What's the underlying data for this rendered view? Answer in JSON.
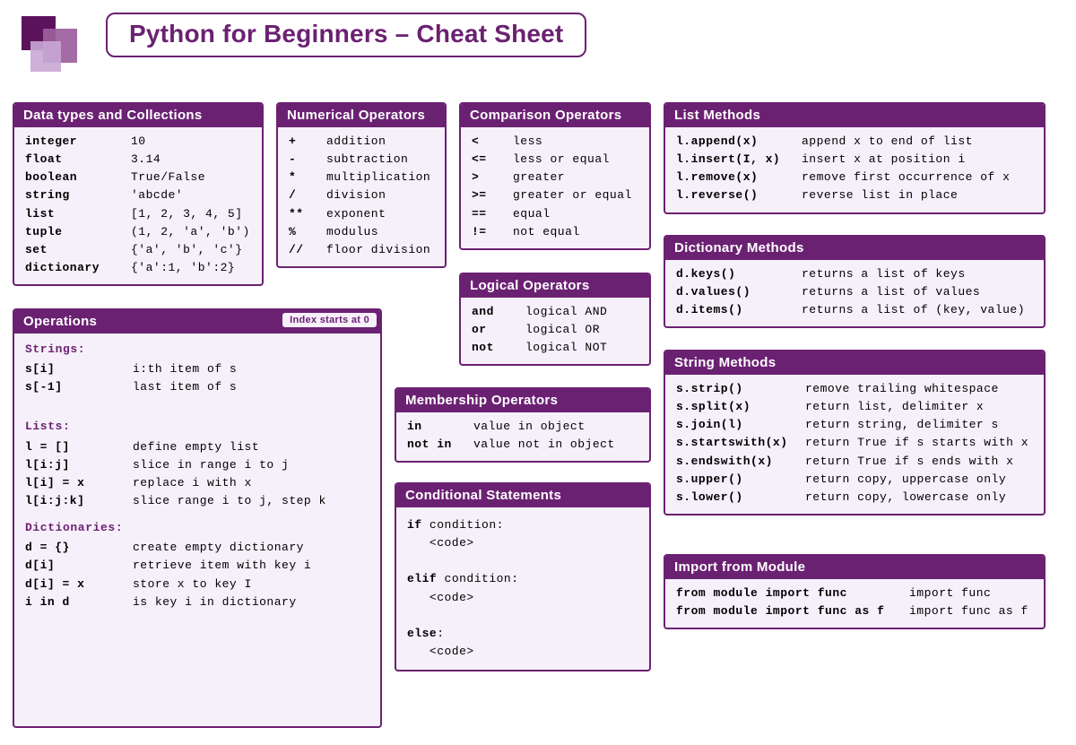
{
  "title": "Python for Beginners – Cheat Sheet",
  "cards": {
    "datatypes": {
      "header": "Data types and Collections",
      "rows": [
        {
          "k": "integer",
          "v": "10"
        },
        {
          "k": "float",
          "v": "3.14"
        },
        {
          "k": "boolean",
          "v": "True/False"
        },
        {
          "k": "string",
          "v": "'abcde'"
        },
        {
          "k": "list",
          "v": "[1, 2, 3, 4, 5]"
        },
        {
          "k": "tuple",
          "v": "(1, 2, 'a', 'b')"
        },
        {
          "k": "set",
          "v": "{'a', 'b', 'c'}"
        },
        {
          "k": "dictionary",
          "v": "{'a':1, 'b':2}"
        }
      ]
    },
    "operations": {
      "header": "Operations",
      "badge": "Index starts at 0",
      "sections": {
        "strings": {
          "title": "Strings:",
          "rows": [
            {
              "k": "s[i]",
              "v": "i:th item of s"
            },
            {
              "k": "s[-1]",
              "v": "last item of s"
            }
          ]
        },
        "lists": {
          "title": "Lists:",
          "rows": [
            {
              "k": "l = []",
              "v": "define empty list"
            },
            {
              "k": "l[i:j]",
              "v": "slice in range i to j"
            },
            {
              "k": "l[i] = x",
              "v": "replace i with x"
            },
            {
              "k": "l[i:j:k]",
              "v": "slice range i to j, step k"
            }
          ]
        },
        "dicts": {
          "title": "Dictionaries:",
          "rows": [
            {
              "k": "d = {}",
              "v": "create empty dictionary"
            },
            {
              "k": "d[i]",
              "v": "retrieve item with key i"
            },
            {
              "k": "d[i] = x",
              "v": "store x to key I"
            },
            {
              "k": "i in d",
              "v": "is key i in dictionary"
            }
          ]
        }
      }
    },
    "numops": {
      "header": "Numerical Operators",
      "rows": [
        {
          "k": "+",
          "v": "addition"
        },
        {
          "k": "-",
          "v": "subtraction"
        },
        {
          "k": "*",
          "v": "multiplication"
        },
        {
          "k": "/",
          "v": "division"
        },
        {
          "k": "**",
          "v": "exponent"
        },
        {
          "k": "%",
          "v": "modulus"
        },
        {
          "k": "//",
          "v": "floor division"
        }
      ]
    },
    "cmpops": {
      "header": "Comparison Operators",
      "rows": [
        {
          "k": "<",
          "v": "less"
        },
        {
          "k": "<=",
          "v": "less or equal"
        },
        {
          "k": ">",
          "v": "greater"
        },
        {
          "k": ">=",
          "v": "greater or equal"
        },
        {
          "k": "==",
          "v": "equal"
        },
        {
          "k": "!=",
          "v": "not equal"
        }
      ]
    },
    "logops": {
      "header": "Logical Operators",
      "rows": [
        {
          "k": "and",
          "v": "logical AND"
        },
        {
          "k": "or",
          "v": "logical OR"
        },
        {
          "k": "not",
          "v": "logical NOT"
        }
      ]
    },
    "memops": {
      "header": "Membership Operators",
      "rows": [
        {
          "k": "in",
          "v": "value in object"
        },
        {
          "k": "not in",
          "v": "value not in object"
        }
      ]
    },
    "cond": {
      "header": "Conditional Statements",
      "lines": [
        {
          "bold": "if",
          "rest": " condition:"
        },
        {
          "bold": "",
          "rest": "   <code>"
        },
        {
          "bold": "",
          "rest": ""
        },
        {
          "bold": "elif",
          "rest": " condition:"
        },
        {
          "bold": "",
          "rest": "   <code>"
        },
        {
          "bold": "",
          "rest": ""
        },
        {
          "bold": "else",
          "rest": ":"
        },
        {
          "bold": "",
          "rest": "   <code>"
        }
      ]
    },
    "listm": {
      "header": "List Methods",
      "rows": [
        {
          "k": "l.append(x)",
          "v": "append x to end of list"
        },
        {
          "k": "l.insert(I, x)",
          "v": "insert x at position i"
        },
        {
          "k": "l.remove(x)",
          "v": "remove first occurrence of x"
        },
        {
          "k": "l.reverse()",
          "v": "reverse list in place"
        }
      ]
    },
    "dictm": {
      "header": "Dictionary Methods",
      "rows": [
        {
          "k": "d.keys()",
          "v": "returns a list of keys"
        },
        {
          "k": "d.values()",
          "v": "returns a list of values"
        },
        {
          "k": "d.items()",
          "v": "returns a list of (key, value)"
        }
      ]
    },
    "strm": {
      "header": "String Methods",
      "rows": [
        {
          "k": "s.strip()",
          "v": "remove trailing whitespace"
        },
        {
          "k": "s.split(x)",
          "v": "return list, delimiter x"
        },
        {
          "k": "s.join(l)",
          "v": "return string, delimiter s"
        },
        {
          "k": "s.startswith(x)",
          "v": "return True if s starts with x"
        },
        {
          "k": "s.endswith(x)",
          "v": "return True if s ends with x"
        },
        {
          "k": "s.upper()",
          "v": "return copy, uppercase only"
        },
        {
          "k": "s.lower()",
          "v": "return copy, lowercase only"
        }
      ]
    },
    "import": {
      "header": "Import from Module",
      "rows": [
        {
          "k": "from module import func",
          "v": "import func"
        },
        {
          "k": "from module import func as f",
          "v": "import func as f"
        }
      ]
    }
  }
}
